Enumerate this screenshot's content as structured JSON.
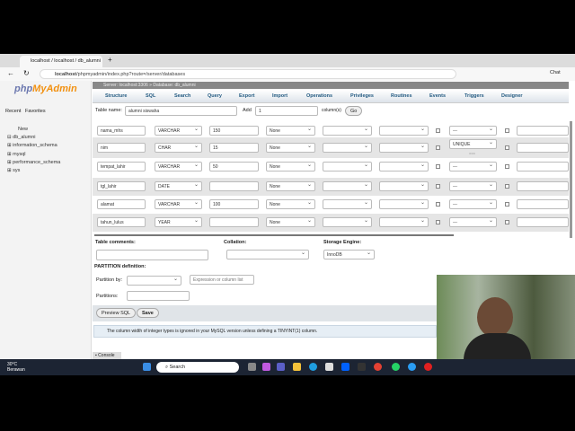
{
  "browser": {
    "tab_title": "localhost / localhost / db_alumni",
    "url_host": "localhost",
    "url_path": "/phpmyadmin/index.php?route=/server/databases",
    "chat": "Chat"
  },
  "sidebar": {
    "logo_php": "php",
    "logo_mya": "MyAdmin",
    "recent": "Recent",
    "favorites": "Favorites",
    "items": [
      "New",
      "db_alumni",
      "information_schema",
      "mysql",
      "performance_schema",
      "sys"
    ]
  },
  "breadcrumb": {
    "server": "Server: localhost:3306",
    "database": "Database: db_alumni"
  },
  "menu": [
    "Structure",
    "SQL",
    "Search",
    "Query",
    "Export",
    "Import",
    "Operations",
    "Privileges",
    "Routines",
    "Events",
    "Triggers",
    "Designer"
  ],
  "form": {
    "table_name_label": "Table name:",
    "table_name": "alumni siswaha",
    "add_label": "Add",
    "add_count": "1",
    "columns_label": "column(s)",
    "go": "Go"
  },
  "columns": [
    {
      "name": "nama_mhs",
      "type": "VARCHAR",
      "length": "150",
      "default": "None",
      "index": "---"
    },
    {
      "name": "nim",
      "type": "CHAR",
      "length": "15",
      "default": "None",
      "index": "UNIQUE",
      "extra": "==="
    },
    {
      "name": "tempat_lahir",
      "type": "VARCHAR",
      "length": "50",
      "default": "None",
      "index": "---"
    },
    {
      "name": "tgl_lahir",
      "type": "DATE",
      "length": "",
      "default": "None",
      "index": "---"
    },
    {
      "name": "alamat",
      "type": "VARCHAR",
      "length": "100",
      "default": "None",
      "index": "---"
    },
    {
      "name": "tahun_lulus",
      "type": "YEAR",
      "length": "",
      "default": "None",
      "index": "---"
    }
  ],
  "table_opts": {
    "comments_label": "Table comments:",
    "collation_label": "Collation:",
    "engine_label": "Storage Engine:",
    "engine": "InnoDB",
    "partition_label": "PARTITION definition:",
    "partition_by": "Partition by:",
    "expr_placeholder": "Expression or column list",
    "partitions": "Partitions:",
    "preview": "Preview SQL",
    "save": "Save"
  },
  "notice": "The column width of integer types is ignored in your MySQL version unless defining a TINYINT(1) column.",
  "console": "Console",
  "taskbar": {
    "temp": "30°C",
    "weather": "Berawan",
    "search": "Search"
  }
}
